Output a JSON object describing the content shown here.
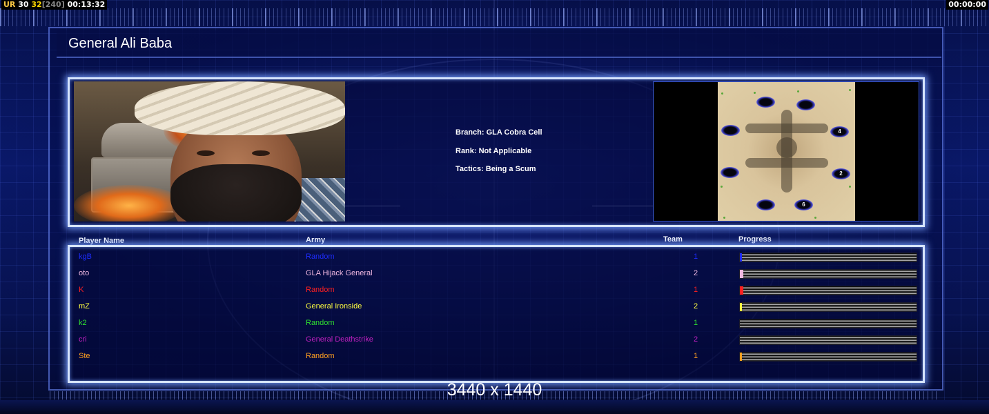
{
  "hud": {
    "left": {
      "a": "UR",
      "b": "30",
      "c": "32",
      "d": "[240]",
      "e": "00:13:32"
    },
    "right_time": "00:00:00"
  },
  "general": {
    "title": "General Ali Baba",
    "branch": "Branch: GLA Cobra Cell",
    "rank": "Rank: Not Applicable",
    "tactics": "Tactics: Being a Scum"
  },
  "map": {
    "slots": [
      {
        "label": ""
      },
      {
        "label": ""
      },
      {
        "label": ""
      },
      {
        "label": "4"
      },
      {
        "label": ""
      },
      {
        "label": "2"
      },
      {
        "label": ""
      },
      {
        "label": "6"
      }
    ]
  },
  "table": {
    "headers": {
      "name": "Player Name",
      "army": "Army",
      "team": "Team",
      "progress": "Progress"
    },
    "rows": [
      {
        "name": "kgB",
        "army": "Random",
        "team": "1",
        "color": "#1e2cff",
        "progress": 0.01
      },
      {
        "name": "oto",
        "army": "GLA Hijack General",
        "team": "2",
        "color": "#f0b8e0",
        "progress": 0.02
      },
      {
        "name": "K",
        "army": "Random",
        "team": "1",
        "color": "#ff2020",
        "progress": 0.02
      },
      {
        "name": "mZ",
        "army": "General Ironside",
        "team": "2",
        "color": "#ffff40",
        "progress": 0.01
      },
      {
        "name": "k2",
        "army": "Random",
        "team": "1",
        "color": "#30e030",
        "progress": 0.0
      },
      {
        "name": "cri",
        "army": "General Deathstrike",
        "team": "2",
        "color": "#c020c0",
        "progress": 0.0
      },
      {
        "name": "Ste",
        "army": "Random",
        "team": "1",
        "color": "#ffa020",
        "progress": 0.01
      }
    ]
  },
  "resolution": "3440 x 1440"
}
